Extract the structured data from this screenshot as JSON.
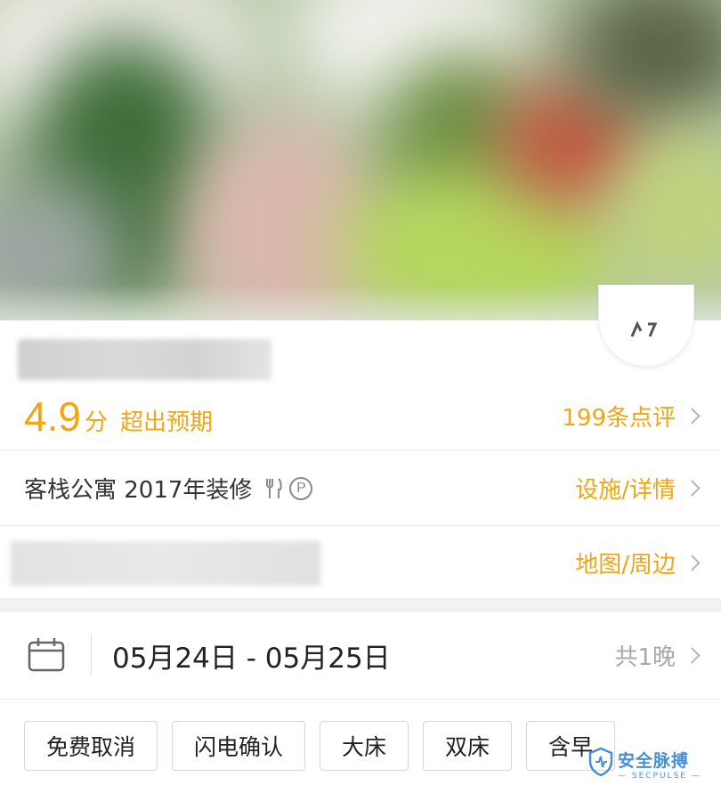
{
  "rating": {
    "score": "4.9",
    "unit": "分",
    "description": "超出预期",
    "reviews_label": "199条点评"
  },
  "facility": {
    "summary": "客栈公寓 2017年装修",
    "parking_symbol": "P",
    "details_label": "设施/详情",
    "icons": [
      "restaurant-icon",
      "parking-icon"
    ]
  },
  "address": {
    "map_label": "地图/周边"
  },
  "booking": {
    "date_range": "05月24日 - 05月25日",
    "nights": "共1晚"
  },
  "tags": [
    "免费取消",
    "闪电确认",
    "大床",
    "双床",
    "含早"
  ],
  "watermark": {
    "title": "安全脉搏",
    "subtitle": "— SECPULSE —"
  },
  "colors": {
    "accent": "#f0a713",
    "muted": "#a8a8a8",
    "watermark": "#4a8fd4"
  }
}
